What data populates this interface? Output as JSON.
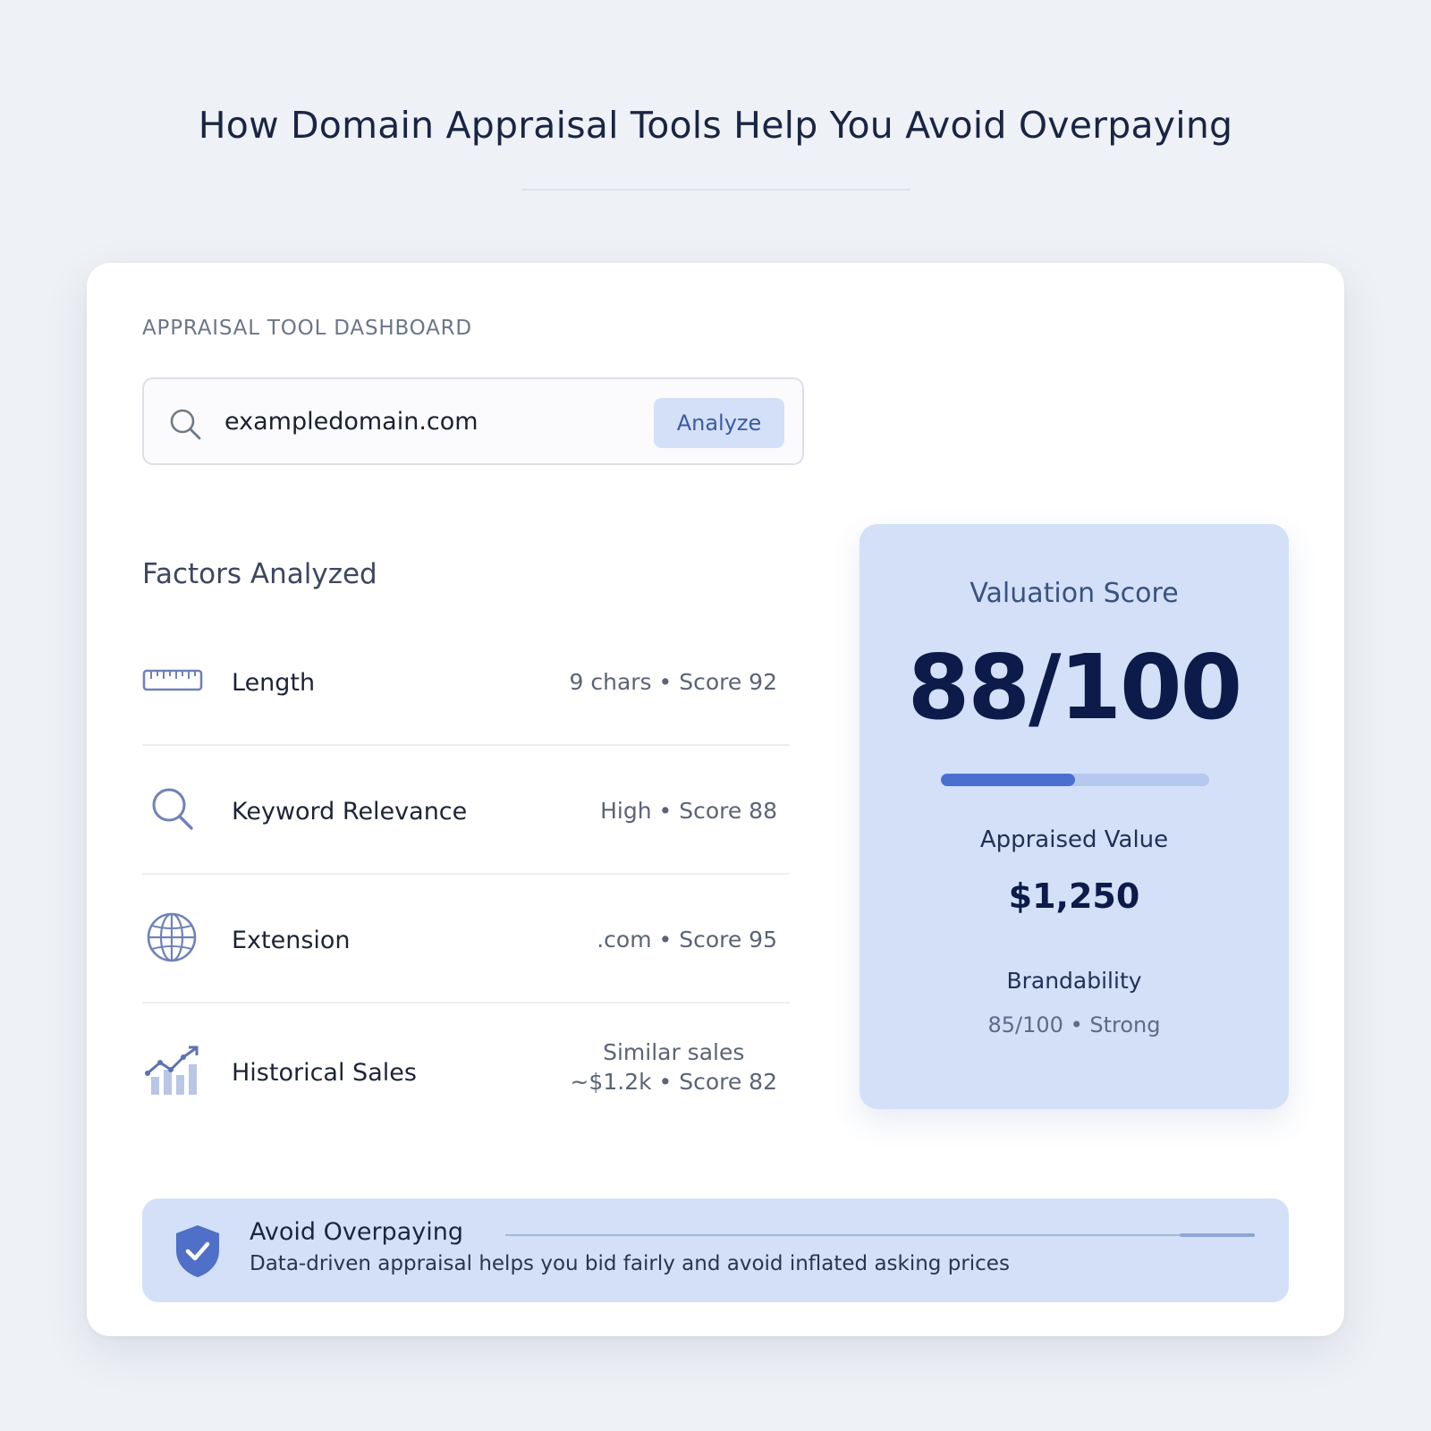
{
  "page": {
    "title": "How Domain Appraisal Tools Help You Avoid Overpaying"
  },
  "dashboard": {
    "label": "APPRAISAL TOOL DASHBOARD",
    "search": {
      "value": "exampledomain.com",
      "button_label": "Analyze"
    },
    "factors_title": "Factors Analyzed",
    "factors": [
      {
        "name": "Length",
        "value": "9 chars • Score 92",
        "icon": "ruler-icon"
      },
      {
        "name": "Keyword Relevance",
        "value": "High • Score 88",
        "icon": "search-icon"
      },
      {
        "name": "Extension",
        "value": ".com • Score 95",
        "icon": "globe-icon"
      },
      {
        "name": "Historical Sales",
        "value_line1": "Similar sales",
        "value_line2": "~$1.2k • Score 82",
        "icon": "trending-chart-icon"
      }
    ],
    "score": {
      "label": "Valuation Score",
      "value": "88/100",
      "progress_fraction": 0.5,
      "appraised_label": "Appraised Value",
      "appraised_value": "$1,250",
      "brandability_label": "Brandability",
      "brandability_value": "85/100 • Strong"
    },
    "banner": {
      "title": "Avoid Overpaying",
      "text": "Data-driven appraisal helps you bid fairly and avoid inflated asking prices",
      "icon": "shield-check-icon"
    }
  },
  "colors": {
    "background": "#eef1f5",
    "accent": "#4a6fd1",
    "panel": "#d3e0f7",
    "title_text": "#1a2444"
  }
}
